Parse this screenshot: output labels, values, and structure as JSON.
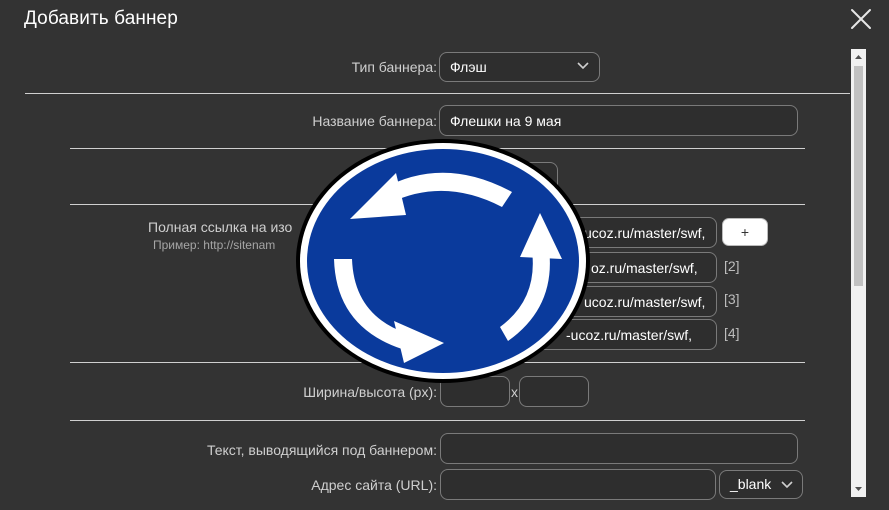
{
  "dialog": {
    "title": "Добавить баннер",
    "close_icon": "close-icon"
  },
  "form": {
    "banner_type": {
      "label": "Тип баннера:",
      "value": "Флэш"
    },
    "banner_name": {
      "label": "Название баннера:",
      "value": "Флешки на 9 мая"
    },
    "image_links": {
      "label": "Полная ссылка на изо",
      "hint": "Пример: http://sitenam",
      "add_label": "+",
      "items": [
        {
          "value": "ucoz.ru/master/swf,",
          "index": ""
        },
        {
          "value": "oz.ru/master/swf,",
          "index": "[2]"
        },
        {
          "value": "ucoz.ru/master/swf,",
          "index": "[3]"
        },
        {
          "value": "-ucoz.ru/master/swf,",
          "index": "[4]"
        }
      ]
    },
    "size": {
      "label": "Ширина/высота (px):",
      "separator": "x"
    },
    "caption": {
      "label": "Текст, выводящийся под баннером:",
      "value": ""
    },
    "site_url": {
      "label": "Адрес сайта (URL):",
      "value": "",
      "target": "_blank"
    }
  },
  "overlay": {
    "icon": "roundabout-sign-icon",
    "colors": {
      "disc": "#0a3a9c",
      "ring": "#ffffff",
      "outline": "#000000"
    }
  },
  "colors": {
    "background": "#333333",
    "field_border": "#7a7a7a",
    "text": "#ffffff"
  }
}
